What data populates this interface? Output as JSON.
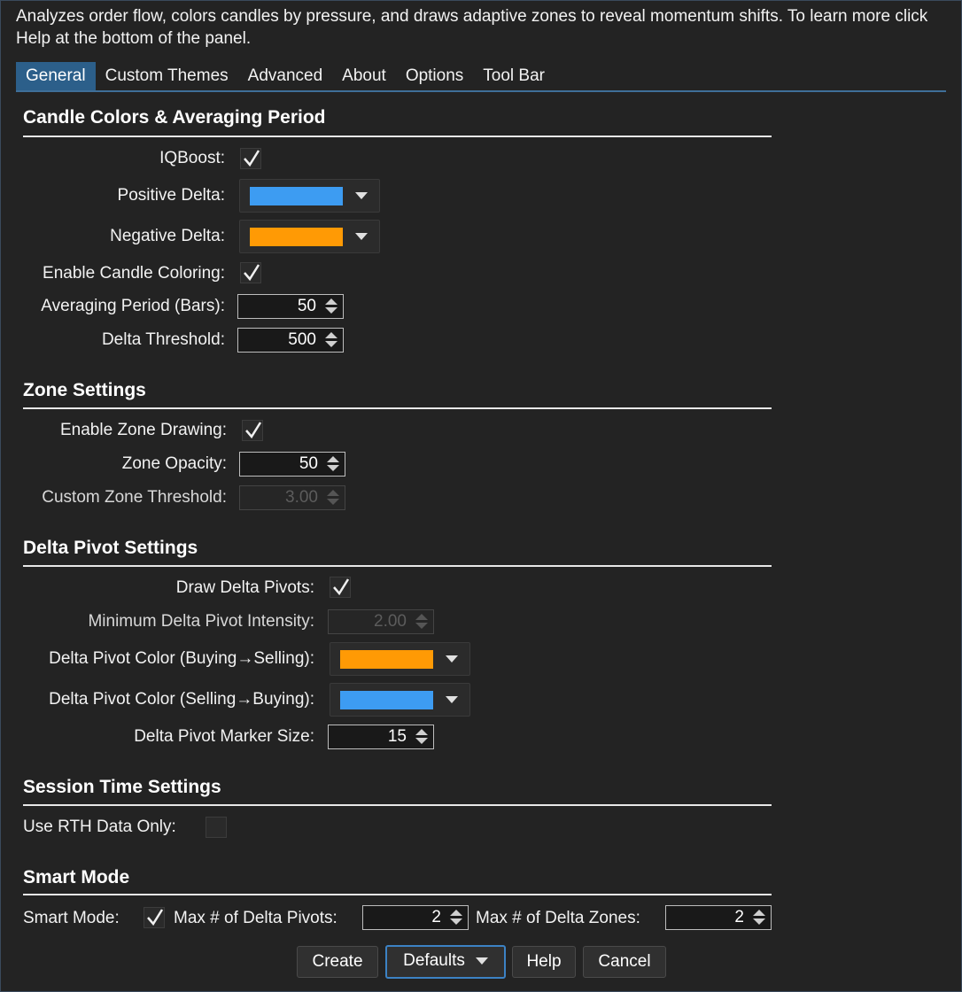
{
  "description": "Analyzes order flow, colors candles by pressure, and draws adaptive zones to reveal momentum shifts. To learn more click Help at the bottom of the panel.",
  "tabs": [
    "General",
    "Custom Themes",
    "Advanced",
    "About",
    "Options",
    "Tool Bar"
  ],
  "active_tab": "General",
  "sections": {
    "candle": {
      "title": "Candle Colors & Averaging Period",
      "iqboost_label": "IQBoost:",
      "positive_delta_label": "Positive Delta:",
      "positive_delta_color": "#3d9cf2",
      "negative_delta_label": "Negative Delta:",
      "negative_delta_color": "#ff9a05",
      "enable_candle_coloring_label": "Enable Candle Coloring:",
      "averaging_period_label": "Averaging Period (Bars):",
      "averaging_period_value": "50",
      "delta_threshold_label": "Delta Threshold:",
      "delta_threshold_value": "500"
    },
    "zone": {
      "title": "Zone Settings",
      "enable_zone_drawing_label": "Enable Zone Drawing:",
      "zone_opacity_label": "Zone Opacity:",
      "zone_opacity_value": "50",
      "custom_zone_threshold_label": "Custom Zone Threshold:",
      "custom_zone_threshold_value": "3.00"
    },
    "pivot": {
      "title": "Delta Pivot Settings",
      "draw_delta_pivots_label": "Draw Delta Pivots:",
      "min_intensity_label": "Minimum Delta Pivot Intensity:",
      "min_intensity_value": "2.00",
      "color_buy_sell_label": "Delta Pivot Color (Buying→Selling):",
      "color_buy_sell": "#ff9a05",
      "color_sell_buy_label": "Delta Pivot Color (Selling→Buying):",
      "color_sell_buy": "#3d9cf2",
      "marker_size_label": "Delta Pivot Marker Size:",
      "marker_size_value": "15"
    },
    "session": {
      "title": "Session Time Settings",
      "rth_label": "Use RTH Data Only:"
    },
    "smart": {
      "title": "Smart Mode",
      "smart_mode_label": "Smart Mode:",
      "max_pivots_label": "Max # of Delta Pivots:",
      "max_pivots_value": "2",
      "max_zones_label": "Max # of Delta Zones:",
      "max_zones_value": "2"
    }
  },
  "buttons": {
    "create": "Create",
    "defaults": "Defaults",
    "help": "Help",
    "cancel": "Cancel"
  }
}
